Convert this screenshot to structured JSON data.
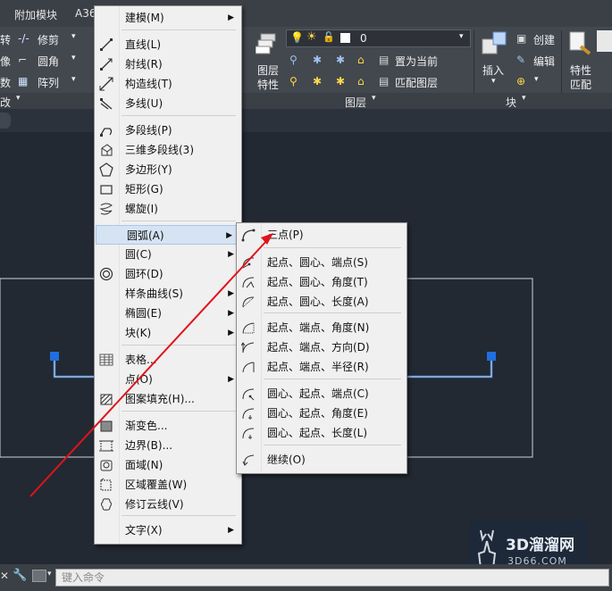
{
  "ribbon": {
    "tabs": [
      "附加模块",
      "A36"
    ],
    "left_items": [
      "转",
      "修剪",
      "像",
      "圆角",
      "数",
      "阵列"
    ],
    "left_panel_title": "改",
    "layer": {
      "current": "0",
      "layer_props_label": [
        "图层",
        "特性"
      ],
      "set_current": "置为当前",
      "match_layer": "匹配图层",
      "panel_title": "图层"
    },
    "block": {
      "insert": "插入",
      "create": "创建",
      "edit": "编辑",
      "panel_title": "块"
    },
    "props": {
      "match_label": [
        "特性",
        "匹配"
      ]
    }
  },
  "draw_menu": {
    "items": [
      {
        "label": "建模(M)",
        "icon": "none",
        "submenu": true
      },
      {
        "label": "直线(L)",
        "icon": "line-icon"
      },
      {
        "label": "射线(R)",
        "icon": "ray-icon"
      },
      {
        "label": "构造线(T)",
        "icon": "xline-icon"
      },
      {
        "label": "多线(U)",
        "icon": "mline-icon"
      },
      {
        "label": "多段线(P)",
        "icon": "polyline-icon"
      },
      {
        "label": "三维多段线(3)",
        "icon": "3dpoly-icon"
      },
      {
        "label": "多边形(Y)",
        "icon": "polygon-icon"
      },
      {
        "label": "矩形(G)",
        "icon": "rectangle-icon"
      },
      {
        "label": "螺旋(I)",
        "icon": "helix-icon"
      },
      {
        "label": "圆弧(A)",
        "icon": "none",
        "submenu": true,
        "highlighted": true
      },
      {
        "label": "圆(C)",
        "icon": "none",
        "submenu": true
      },
      {
        "label": "圆环(D)",
        "icon": "donut-icon"
      },
      {
        "label": "样条曲线(S)",
        "icon": "none",
        "submenu": true
      },
      {
        "label": "椭圆(E)",
        "icon": "none",
        "submenu": true
      },
      {
        "label": "块(K)",
        "icon": "none",
        "submenu": true
      },
      {
        "label": "表格...",
        "icon": "table-icon"
      },
      {
        "label": "点(O)",
        "icon": "none",
        "submenu": true
      },
      {
        "label": "图案填充(H)...",
        "icon": "hatch-icon"
      },
      {
        "label": "渐变色...",
        "icon": "gradient-icon"
      },
      {
        "label": "边界(B)...",
        "icon": "boundary-icon"
      },
      {
        "label": "面域(N)",
        "icon": "region-icon"
      },
      {
        "label": "区域覆盖(W)",
        "icon": "wipeout-icon"
      },
      {
        "label": "修订云线(V)",
        "icon": "revcloud-icon"
      },
      {
        "label": "文字(X)",
        "icon": "none",
        "submenu": true
      }
    ]
  },
  "arc_submenu": {
    "items": [
      {
        "label": "三点(P)",
        "icon": "arc-3point-icon"
      },
      {
        "label": "起点、圆心、端点(S)",
        "icon": "arc-sce-icon"
      },
      {
        "label": "起点、圆心、角度(T)",
        "icon": "arc-sca-icon"
      },
      {
        "label": "起点、圆心、长度(A)",
        "icon": "arc-scl-icon"
      },
      {
        "label": "起点、端点、角度(N)",
        "icon": "arc-sea-icon"
      },
      {
        "label": "起点、端点、方向(D)",
        "icon": "arc-sed-icon"
      },
      {
        "label": "起点、端点、半径(R)",
        "icon": "arc-ser-icon"
      },
      {
        "label": "圆心、起点、端点(C)",
        "icon": "arc-cse-icon"
      },
      {
        "label": "圆心、起点、角度(E)",
        "icon": "arc-csa-icon"
      },
      {
        "label": "圆心、起点、长度(L)",
        "icon": "arc-csl-icon"
      },
      {
        "label": "继续(O)",
        "icon": "arc-continue-icon"
      }
    ]
  },
  "command_line": {
    "placeholder": "键入命令"
  },
  "watermark": {
    "text": "3D溜溜网",
    "url": "3D66.COM"
  },
  "colors": {
    "annotation_arrow": "#e0141a",
    "selection_blue": "#2f7de1"
  }
}
